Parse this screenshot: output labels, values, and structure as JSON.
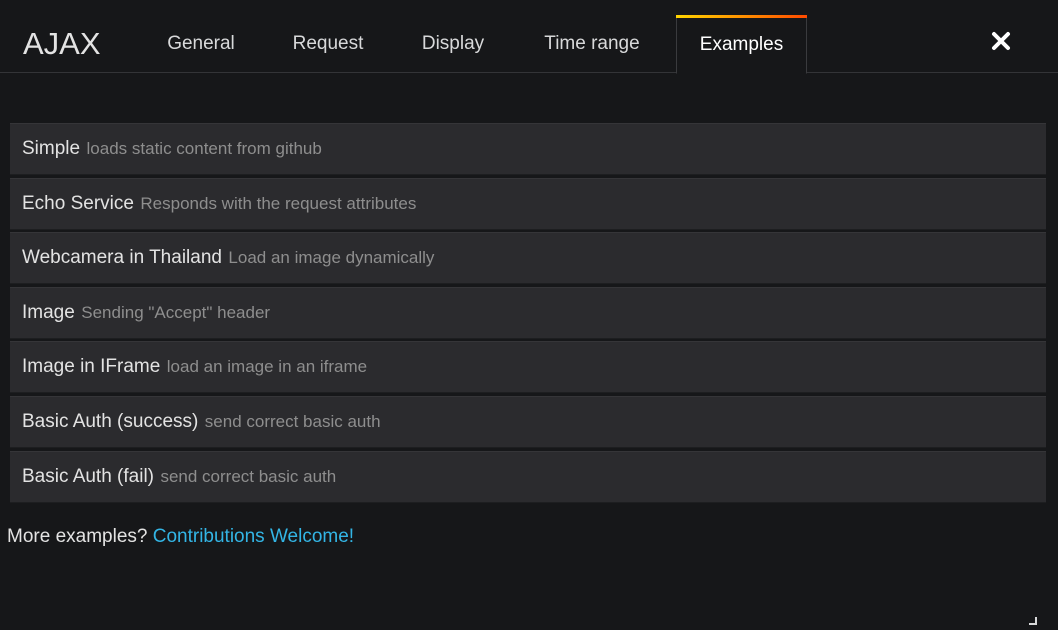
{
  "header": {
    "title": "AJAX",
    "tabs": [
      {
        "label": "General"
      },
      {
        "label": "Request"
      },
      {
        "label": "Display"
      },
      {
        "label": "Time range"
      },
      {
        "label": "Examples"
      }
    ],
    "active_tab": "Examples",
    "close_icon": "close-icon"
  },
  "examples": [
    {
      "name": "Simple",
      "desc": "loads static content from github"
    },
    {
      "name": "Echo Service",
      "desc": "Responds with the request attributes"
    },
    {
      "name": "Webcamera in Thailand",
      "desc": "Load an image dynamically"
    },
    {
      "name": "Image",
      "desc": "Sending \"Accept\" header"
    },
    {
      "name": "Image in IFrame",
      "desc": "load an image in an iframe"
    },
    {
      "name": "Basic Auth (success)",
      "desc": "send correct basic auth"
    },
    {
      "name": "Basic Auth (fail)",
      "desc": "send correct basic auth"
    }
  ],
  "footer": {
    "prompt": "More examples?",
    "link": "Contributions Welcome!"
  },
  "colors": {
    "background": "#161719",
    "row_background": "#2b2b2e",
    "link": "#33b5e5",
    "tab_accent_start": "#ffd500",
    "tab_accent_end": "#ff4a00"
  }
}
